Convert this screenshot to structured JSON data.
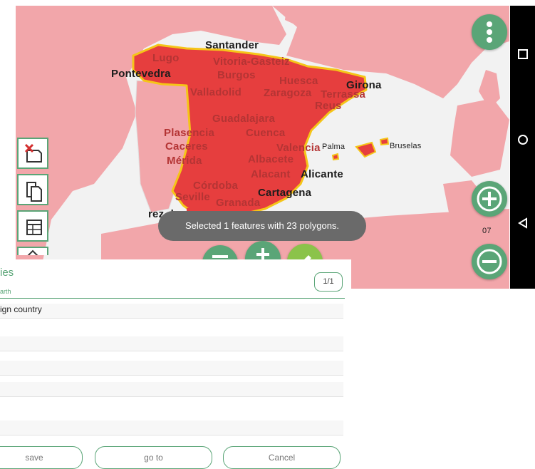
{
  "map": {
    "cities_spain": [
      {
        "id": "santander",
        "label": "Santander",
        "style": "dark"
      },
      {
        "id": "pontevedra",
        "label": "Pontevedra",
        "style": "dark"
      },
      {
        "id": "lugo",
        "label": "Lugo",
        "style": "red"
      },
      {
        "id": "vitoria",
        "label": "Vitoria-Gasteiz",
        "style": "red"
      },
      {
        "id": "burgos",
        "label": "Burgos",
        "style": "red"
      },
      {
        "id": "huesca",
        "label": "Huesca",
        "style": "red"
      },
      {
        "id": "girona",
        "label": "Girona",
        "style": "dark"
      },
      {
        "id": "valladolid",
        "label": "Valladolid",
        "style": "red"
      },
      {
        "id": "zaragoza",
        "label": "Zaragoza",
        "style": "red"
      },
      {
        "id": "terrassa",
        "label": "Terrassa",
        "style": "red"
      },
      {
        "id": "reus",
        "label": "Reus",
        "style": "red"
      },
      {
        "id": "guadalajara",
        "label": "Guadalajara",
        "style": "red"
      },
      {
        "id": "plasencia",
        "label": "Plasencia",
        "style": "red"
      },
      {
        "id": "cuenca",
        "label": "Cuenca",
        "style": "red"
      },
      {
        "id": "caceres",
        "label": "Caceres",
        "style": "red"
      },
      {
        "id": "merida",
        "label": "Mérida",
        "style": "red"
      },
      {
        "id": "valencia",
        "label": "Valencia",
        "style": "red"
      },
      {
        "id": "palma",
        "label": "Palma",
        "style": "dark"
      },
      {
        "id": "bruselas",
        "label": "Bruselas",
        "style": "small"
      },
      {
        "id": "albacete",
        "label": "Albacete",
        "style": "red"
      },
      {
        "id": "alicante_red",
        "label": "Alacant",
        "style": "red"
      },
      {
        "id": "alicante",
        "label": "Alicante",
        "style": "dark"
      },
      {
        "id": "cordoba",
        "label": "Córdoba",
        "style": "red"
      },
      {
        "id": "seville",
        "label": "Seville",
        "style": "red"
      },
      {
        "id": "granada",
        "label": "Granada",
        "style": "red"
      },
      {
        "id": "cartagena",
        "label": "Cartagena",
        "style": "dark"
      },
      {
        "id": "rezde",
        "label": "rez de",
        "style": "dark"
      },
      {
        "id": "zoom",
        "label": "07",
        "style": "small"
      }
    ],
    "colors": {
      "background": "#f2f2f2",
      "country": "#f2a6aa",
      "selected": "#e63e3e",
      "selected_border": "#f5c518",
      "accent": "#5aa577"
    }
  },
  "toast": "Selected 1 features with 23 polygons.",
  "tools": [
    {
      "icon": "clear-selection-icon"
    },
    {
      "icon": "copy-icon"
    },
    {
      "icon": "table-icon"
    },
    {
      "icon": "edit-icon"
    }
  ],
  "fabs": [
    {
      "icon": "more-vert-icon"
    },
    {
      "icon": "zoom-in-icon"
    },
    {
      "icon": "zoom-out-icon"
    },
    {
      "icon": "layers-icon"
    },
    {
      "icon": "add-feature-icon"
    },
    {
      "icon": "edit-feature-icon"
    }
  ],
  "panel": {
    "title": "ies",
    "subtitle": "arth",
    "page": "1/1",
    "fields": [
      {
        "label": "",
        "value": "ign country"
      },
      {
        "label": "",
        "value": ""
      },
      {
        "label": "",
        "value": ""
      },
      {
        "label": "",
        "value": ""
      },
      {
        "label": "",
        "value": ""
      }
    ],
    "buttons": {
      "save": "save",
      "goto": "go to",
      "cancel": "Cancel"
    }
  },
  "navbar": {
    "icons": [
      "recent-apps-icon",
      "home-icon",
      "back-icon"
    ]
  }
}
